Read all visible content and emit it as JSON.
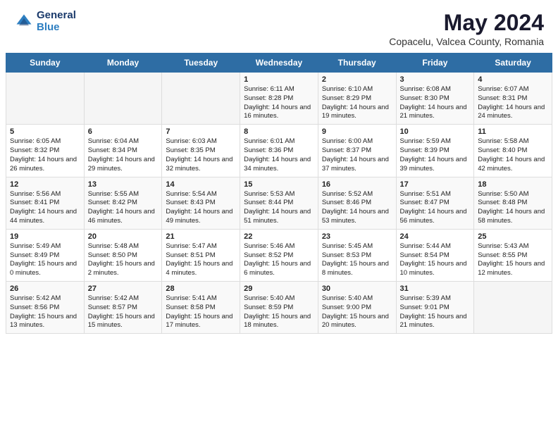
{
  "header": {
    "logo_general": "General",
    "logo_blue": "Blue",
    "month_year": "May 2024",
    "location": "Copacelu, Valcea County, Romania"
  },
  "calendar": {
    "days_of_week": [
      "Sunday",
      "Monday",
      "Tuesday",
      "Wednesday",
      "Thursday",
      "Friday",
      "Saturday"
    ],
    "weeks": [
      [
        {
          "day": "",
          "info": ""
        },
        {
          "day": "",
          "info": ""
        },
        {
          "day": "",
          "info": ""
        },
        {
          "day": "1",
          "info": "Sunrise: 6:11 AM\nSunset: 8:28 PM\nDaylight: 14 hours and 16 minutes."
        },
        {
          "day": "2",
          "info": "Sunrise: 6:10 AM\nSunset: 8:29 PM\nDaylight: 14 hours and 19 minutes."
        },
        {
          "day": "3",
          "info": "Sunrise: 6:08 AM\nSunset: 8:30 PM\nDaylight: 14 hours and 21 minutes."
        },
        {
          "day": "4",
          "info": "Sunrise: 6:07 AM\nSunset: 8:31 PM\nDaylight: 14 hours and 24 minutes."
        }
      ],
      [
        {
          "day": "5",
          "info": "Sunrise: 6:05 AM\nSunset: 8:32 PM\nDaylight: 14 hours and 26 minutes."
        },
        {
          "day": "6",
          "info": "Sunrise: 6:04 AM\nSunset: 8:34 PM\nDaylight: 14 hours and 29 minutes."
        },
        {
          "day": "7",
          "info": "Sunrise: 6:03 AM\nSunset: 8:35 PM\nDaylight: 14 hours and 32 minutes."
        },
        {
          "day": "8",
          "info": "Sunrise: 6:01 AM\nSunset: 8:36 PM\nDaylight: 14 hours and 34 minutes."
        },
        {
          "day": "9",
          "info": "Sunrise: 6:00 AM\nSunset: 8:37 PM\nDaylight: 14 hours and 37 minutes."
        },
        {
          "day": "10",
          "info": "Sunrise: 5:59 AM\nSunset: 8:39 PM\nDaylight: 14 hours and 39 minutes."
        },
        {
          "day": "11",
          "info": "Sunrise: 5:58 AM\nSunset: 8:40 PM\nDaylight: 14 hours and 42 minutes."
        }
      ],
      [
        {
          "day": "12",
          "info": "Sunrise: 5:56 AM\nSunset: 8:41 PM\nDaylight: 14 hours and 44 minutes."
        },
        {
          "day": "13",
          "info": "Sunrise: 5:55 AM\nSunset: 8:42 PM\nDaylight: 14 hours and 46 minutes."
        },
        {
          "day": "14",
          "info": "Sunrise: 5:54 AM\nSunset: 8:43 PM\nDaylight: 14 hours and 49 minutes."
        },
        {
          "day": "15",
          "info": "Sunrise: 5:53 AM\nSunset: 8:44 PM\nDaylight: 14 hours and 51 minutes."
        },
        {
          "day": "16",
          "info": "Sunrise: 5:52 AM\nSunset: 8:46 PM\nDaylight: 14 hours and 53 minutes."
        },
        {
          "day": "17",
          "info": "Sunrise: 5:51 AM\nSunset: 8:47 PM\nDaylight: 14 hours and 56 minutes."
        },
        {
          "day": "18",
          "info": "Sunrise: 5:50 AM\nSunset: 8:48 PM\nDaylight: 14 hours and 58 minutes."
        }
      ],
      [
        {
          "day": "19",
          "info": "Sunrise: 5:49 AM\nSunset: 8:49 PM\nDaylight: 15 hours and 0 minutes."
        },
        {
          "day": "20",
          "info": "Sunrise: 5:48 AM\nSunset: 8:50 PM\nDaylight: 15 hours and 2 minutes."
        },
        {
          "day": "21",
          "info": "Sunrise: 5:47 AM\nSunset: 8:51 PM\nDaylight: 15 hours and 4 minutes."
        },
        {
          "day": "22",
          "info": "Sunrise: 5:46 AM\nSunset: 8:52 PM\nDaylight: 15 hours and 6 minutes."
        },
        {
          "day": "23",
          "info": "Sunrise: 5:45 AM\nSunset: 8:53 PM\nDaylight: 15 hours and 8 minutes."
        },
        {
          "day": "24",
          "info": "Sunrise: 5:44 AM\nSunset: 8:54 PM\nDaylight: 15 hours and 10 minutes."
        },
        {
          "day": "25",
          "info": "Sunrise: 5:43 AM\nSunset: 8:55 PM\nDaylight: 15 hours and 12 minutes."
        }
      ],
      [
        {
          "day": "26",
          "info": "Sunrise: 5:42 AM\nSunset: 8:56 PM\nDaylight: 15 hours and 13 minutes."
        },
        {
          "day": "27",
          "info": "Sunrise: 5:42 AM\nSunset: 8:57 PM\nDaylight: 15 hours and 15 minutes."
        },
        {
          "day": "28",
          "info": "Sunrise: 5:41 AM\nSunset: 8:58 PM\nDaylight: 15 hours and 17 minutes."
        },
        {
          "day": "29",
          "info": "Sunrise: 5:40 AM\nSunset: 8:59 PM\nDaylight: 15 hours and 18 minutes."
        },
        {
          "day": "30",
          "info": "Sunrise: 5:40 AM\nSunset: 9:00 PM\nDaylight: 15 hours and 20 minutes."
        },
        {
          "day": "31",
          "info": "Sunrise: 5:39 AM\nSunset: 9:01 PM\nDaylight: 15 hours and 21 minutes."
        },
        {
          "day": "",
          "info": ""
        }
      ]
    ]
  }
}
